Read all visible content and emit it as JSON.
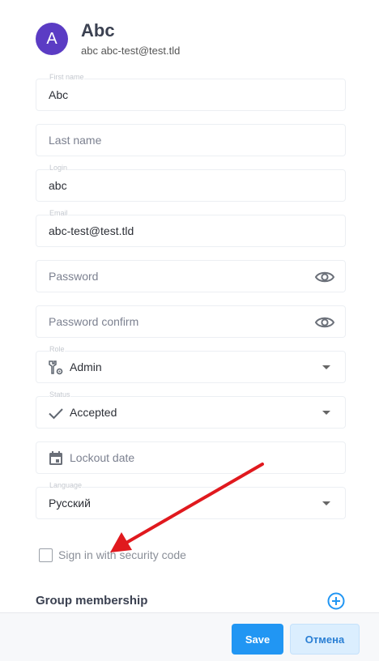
{
  "user": {
    "avatar_letter": "A",
    "name": "Abc",
    "subtitle": "abc abc-test@test.tld"
  },
  "form": {
    "first_name": {
      "label": "First name",
      "value": "Abc"
    },
    "last_name": {
      "placeholder": "Last name"
    },
    "login": {
      "label": "Login",
      "value": "abc"
    },
    "email": {
      "label": "Email",
      "value": "abc-test@test.tld"
    },
    "password": {
      "placeholder": "Password",
      "icon": "eye-icon"
    },
    "password_confirm": {
      "placeholder": "Password confirm",
      "icon": "eye-icon"
    },
    "role": {
      "label": "Role",
      "value": "Admin",
      "icon": "wrench-gear-icon"
    },
    "status": {
      "label": "Status",
      "value": "Accepted",
      "icon": "check-icon"
    },
    "lockout_date": {
      "placeholder": "Lockout date",
      "icon": "calendar-icon"
    },
    "language": {
      "label": "Language",
      "value": "Русский"
    },
    "security_code": {
      "label": "Sign in with security code",
      "checked": false
    }
  },
  "group": {
    "title": "Group membership",
    "add_icon": "plus-circle-icon"
  },
  "footer": {
    "save_label": "Save",
    "cancel_label": "Отмена"
  },
  "colors": {
    "avatar": "#5b3cc4",
    "primary": "#2196f3",
    "annotation_arrow": "#e0191e"
  }
}
